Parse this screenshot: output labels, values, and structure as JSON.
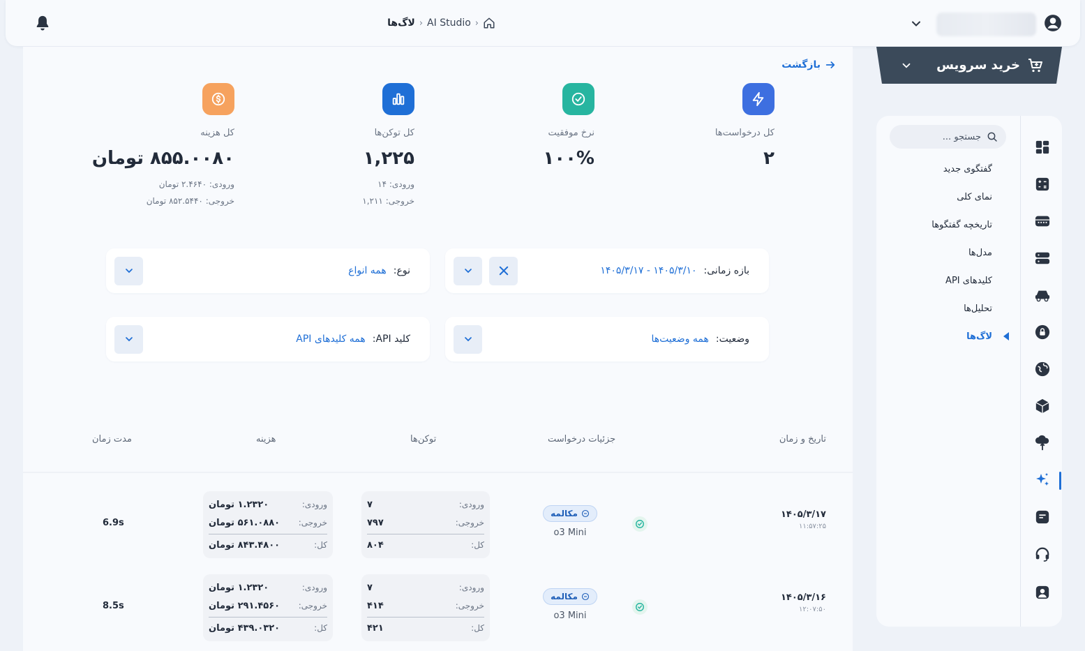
{
  "header": {
    "breadcrumb": [
      "AI Studio",
      "لاگ‌ها"
    ]
  },
  "buy_service": {
    "label": "خرید سرویس"
  },
  "sidebar": {
    "search_placeholder": "جستجو ...",
    "items": [
      {
        "label": "گفتگوی جدید"
      },
      {
        "label": "نمای کلی"
      },
      {
        "label": "تاریخچه گفتگوها"
      },
      {
        "label": "مدل‌ها"
      },
      {
        "label": "کلیدهای API"
      },
      {
        "label": "تحلیل‌ها"
      },
      {
        "label": "لاگ‌ها",
        "active": true
      }
    ],
    "rail_icons": [
      "dashboard-icon",
      "calculator-icon",
      "server-icon",
      "database-icon",
      "car-icon",
      "lock-icon",
      "globe-icon",
      "cube-icon",
      "cloud-upload-icon",
      "sparkles-icon",
      "document-icon",
      "headset-icon",
      "contact-icon"
    ]
  },
  "back_label": "بازگشت",
  "stats": [
    {
      "label": "کل درخواست‌ها",
      "value": "۲",
      "color": "#3d6fe0",
      "icon": "bolt-icon"
    },
    {
      "label": "نرخ موفقیت",
      "value": "۱۰۰%",
      "color": "#27b5a0",
      "icon": "check-circle-icon"
    },
    {
      "label": "کل توکن‌ها",
      "value": "۱,۲۲۵",
      "sub1": "ورودی: ۱۴",
      "sub2": "خروجی: ۱,۲۱۱",
      "color": "#1f6fd6",
      "icon": "bar-chart-icon"
    },
    {
      "label": "کل هزینه",
      "value": "۸۵۵.۰۰۸۰ تومان",
      "sub1": "ورودی: ۲.۴۶۴۰ تومان",
      "sub2": "خروجی: ۸۵۲.۵۴۴۰ تومان",
      "color": "#f6a25e",
      "icon": "dollar-icon"
    }
  ],
  "filters": {
    "date_range": {
      "label": "بازه زمانی:",
      "value": "۱۴۰۵/۳/۱۰ - ۱۴۰۵/۳/۱۷"
    },
    "type": {
      "label": "نوع:",
      "value": "همه انواع"
    },
    "status": {
      "label": "وضعیت:",
      "value": "همه وضعیت‌ها"
    },
    "api_key": {
      "label": "کلید API:",
      "value": "همه کلیدهای API"
    }
  },
  "table": {
    "headers": {
      "datetime": "تاریخ و زمان",
      "details": "جزئیات درخواست",
      "tokens": "توکن‌ها",
      "cost": "هزینه",
      "duration": "مدت زمان"
    },
    "labels": {
      "in": "ورودی:",
      "out": "خروجی:",
      "total": "کل:"
    },
    "rows": [
      {
        "date": "۱۴۰۵/۳/۱۷",
        "time": "۱۱:۵۷:۲۵",
        "type": "مکالمه",
        "model": "o3 Mini",
        "tokens_in": "۷",
        "tokens_out": "۷۹۷",
        "tokens_total": "۸۰۴",
        "cost_in": "۱.۲۳۲۰ تومان",
        "cost_out": "۵۶۱.۰۸۸۰ تومان",
        "cost_total": "۸۴۳.۴۸۰۰ تومان",
        "duration": "6.9s"
      },
      {
        "date": "۱۴۰۵/۳/۱۶",
        "time": "۱۲:۰۷:۵۰",
        "type": "مکالمه",
        "model": "o3 Mini",
        "tokens_in": "۷",
        "tokens_out": "۴۱۴",
        "tokens_total": "۴۲۱",
        "cost_in": "۱.۲۳۲۰ تومان",
        "cost_out": "۲۹۱.۴۵۶۰ تومان",
        "cost_total": "۴۳۹.۰۳۲۰ تومان",
        "duration": "8.5s"
      }
    ]
  },
  "colors": {
    "accent": "#1f6fd6",
    "dark": "#3b4a5a",
    "success": "#27b5a0"
  }
}
